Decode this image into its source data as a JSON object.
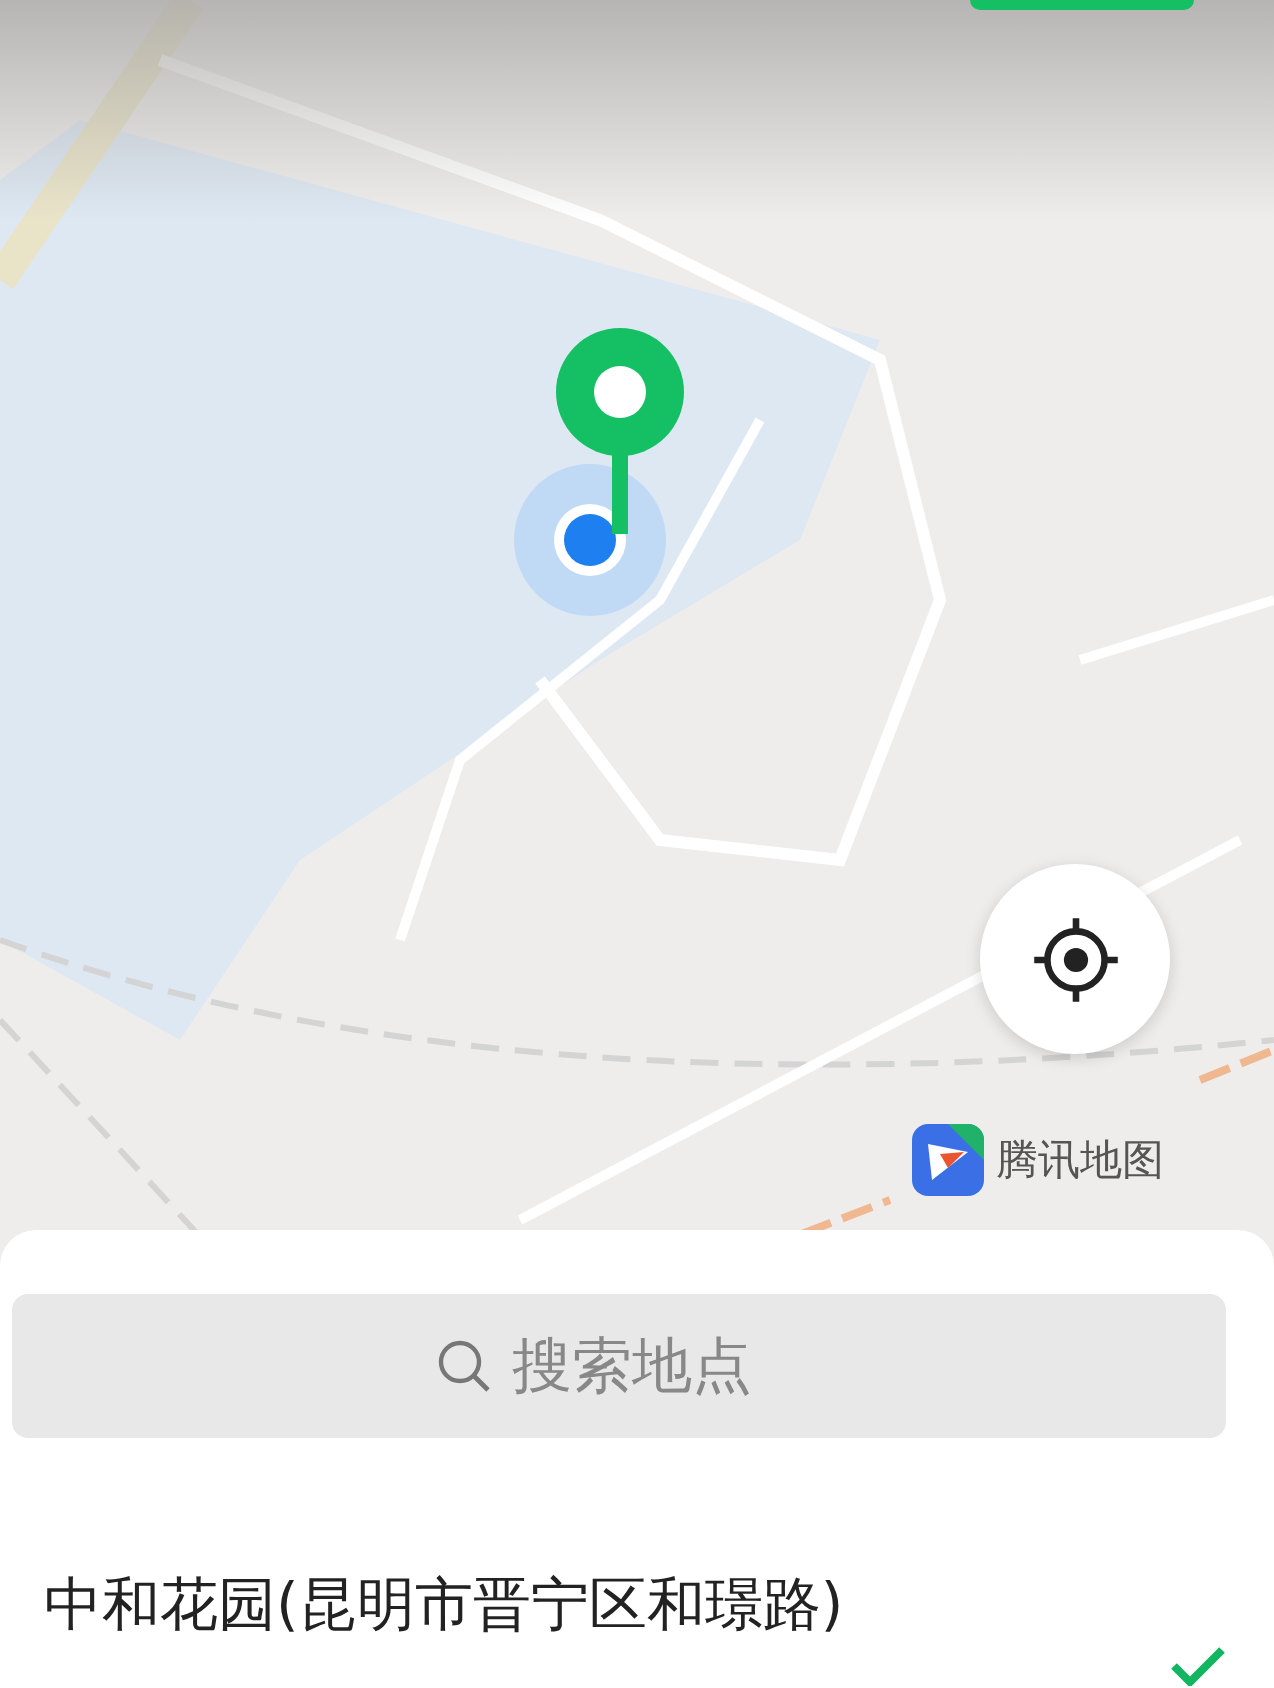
{
  "logo": {
    "text": "腾讯地图"
  },
  "search": {
    "placeholder": "搜索地点"
  },
  "results": [
    {
      "name": "中和花园(昆明市晋宁区和璟路)",
      "selected": true
    }
  ]
}
